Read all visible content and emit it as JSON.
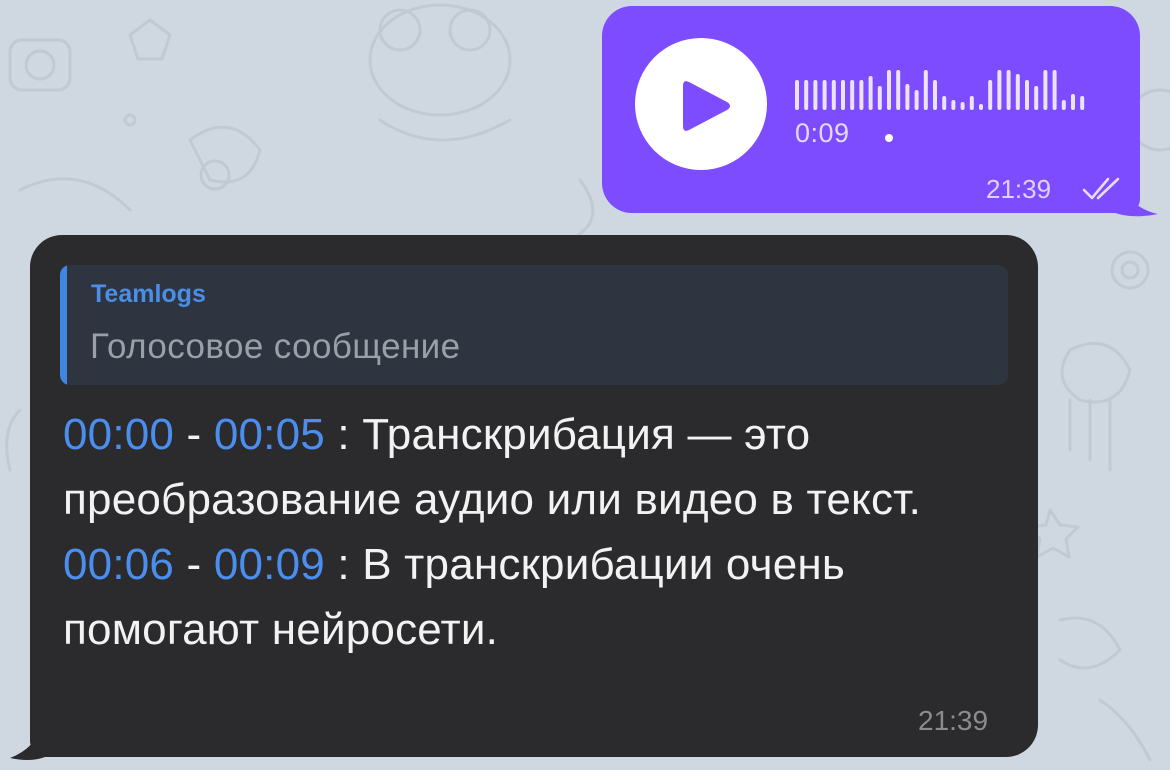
{
  "colors": {
    "chat_background": "#cfd8e0",
    "outgoing_bubble": "#7d4cff",
    "incoming_bubble": "#2b2b2d",
    "reply_background": "#2e3440",
    "reply_accent": "#3f86e0",
    "timestamp_link": "#4a8ff0"
  },
  "outgoing_voice": {
    "play_icon": "play-icon",
    "duration": "0:09",
    "time": "21:39",
    "status_icon": "double-check-icon",
    "status": "read"
  },
  "incoming_message": {
    "reply": {
      "author": "Teamlogs",
      "text": "Голосовое сообщение"
    },
    "segments": [
      {
        "start": "00:00",
        "sep": " - ",
        "end": "00:05",
        "colon": " : ",
        "text": "Транскрибация — это преобразование аудио или видео в текст."
      },
      {
        "start": "00:06",
        "sep": " - ",
        "end": "00:09",
        "colon": " : ",
        "text": "В транскрибации очень помогают нейросети."
      }
    ],
    "time": "21:39"
  }
}
